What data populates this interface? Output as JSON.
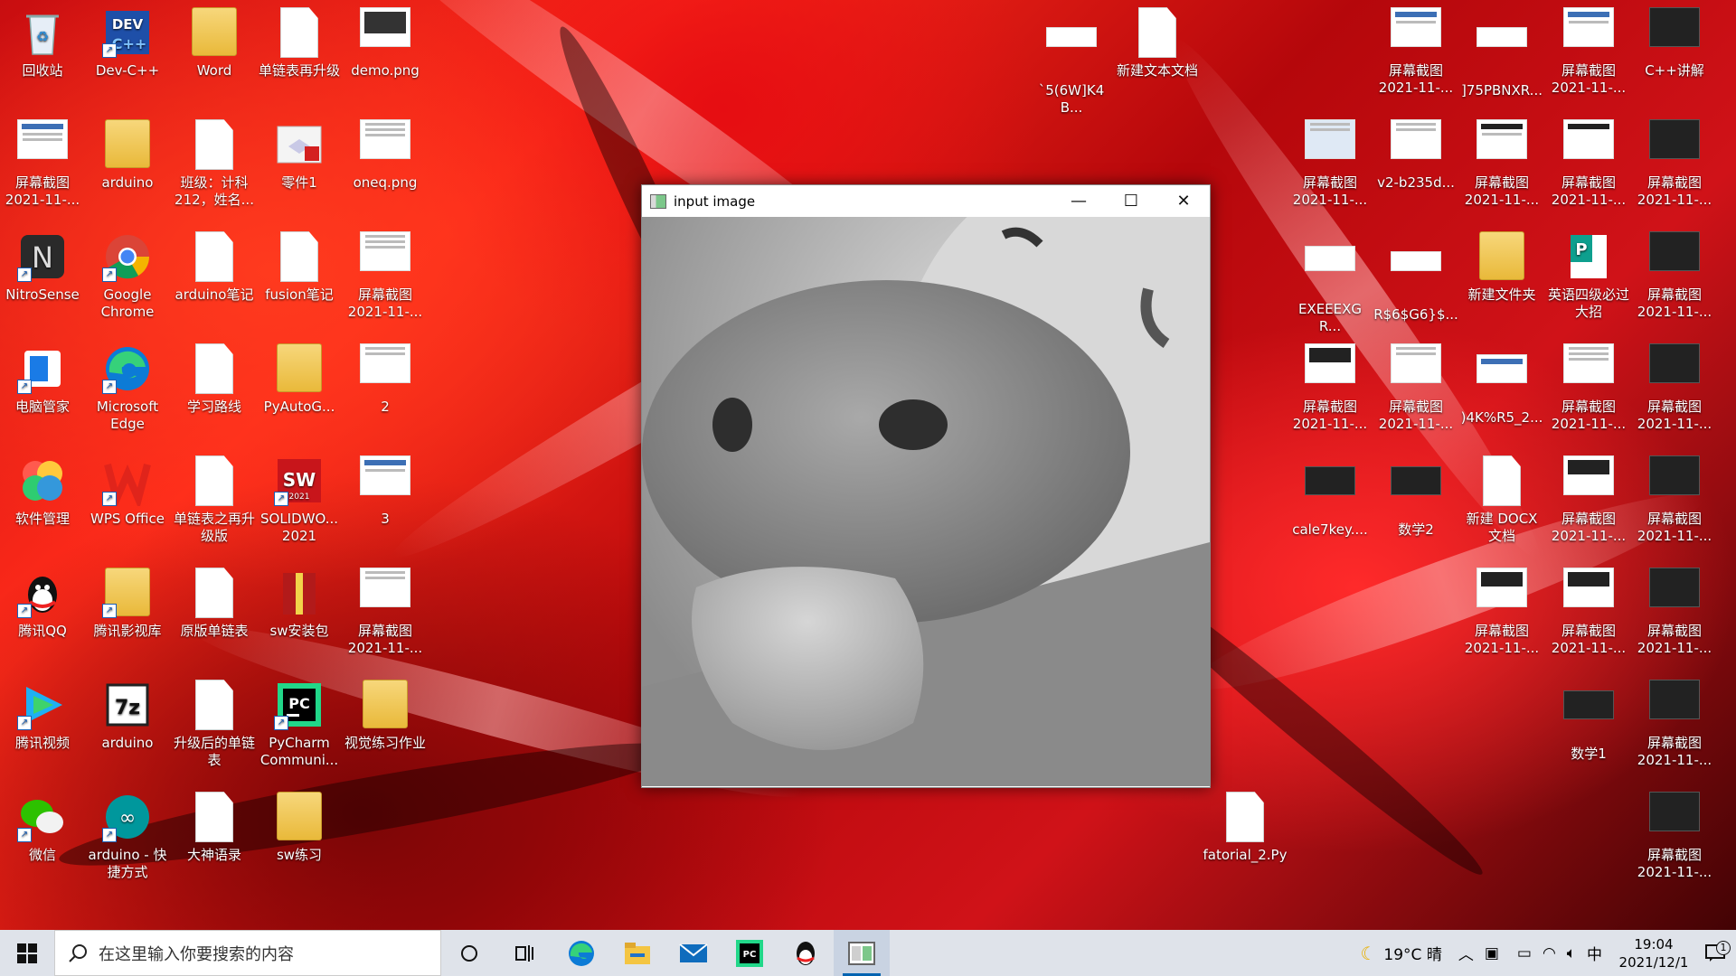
{
  "desktop": {
    "icons": [
      {
        "label": "回收站"
      },
      {
        "label": "Dev-C++"
      },
      {
        "label": "Word"
      },
      {
        "label": "单链表再升级"
      },
      {
        "label": "demo.png"
      },
      {
        "label": "屏幕截图\n2021-11-..."
      },
      {
        "label": "arduino"
      },
      {
        "label": "班级：计科\n212，姓名..."
      },
      {
        "label": "零件1"
      },
      {
        "label": "oneq.png"
      },
      {
        "label": "NitroSense"
      },
      {
        "label": "Google\nChrome"
      },
      {
        "label": "arduino笔记"
      },
      {
        "label": "fusion笔记"
      },
      {
        "label": "屏幕截图\n2021-11-..."
      },
      {
        "label": "电脑管家"
      },
      {
        "label": "Microsoft\nEdge"
      },
      {
        "label": "学习路线"
      },
      {
        "label": "PyAutoG..."
      },
      {
        "label": "2"
      },
      {
        "label": "软件管理"
      },
      {
        "label": "WPS Office"
      },
      {
        "label": "单链表之再升\n级版"
      },
      {
        "label": "SOLIDWO...\n2021"
      },
      {
        "label": "3"
      },
      {
        "label": "腾讯QQ"
      },
      {
        "label": "腾讯影视库"
      },
      {
        "label": "原版单链表"
      },
      {
        "label": "sw安装包"
      },
      {
        "label": "屏幕截图\n2021-11-..."
      },
      {
        "label": "腾讯视频"
      },
      {
        "label": "arduino"
      },
      {
        "label": "升级后的单链\n表"
      },
      {
        "label": "PyCharm\nCommuni..."
      },
      {
        "label": "视觉练习作业"
      },
      {
        "label": "微信"
      },
      {
        "label": "arduino - 快\n捷方式"
      },
      {
        "label": "大神语录"
      },
      {
        "label": "sw练习"
      },
      {
        "label": "`5(6W]K4B..."
      },
      {
        "label": "新建文本文档"
      },
      {
        "label": "fatorial_2.Py"
      },
      {
        "label": "屏幕截图\n2021-11-..."
      },
      {
        "label": "]75PBNXR..."
      },
      {
        "label": "屏幕截图\n2021-11-..."
      },
      {
        "label": "C++讲解"
      },
      {
        "label": "屏幕截图\n2021-11-..."
      },
      {
        "label": "v2-b235d..."
      },
      {
        "label": "屏幕截图\n2021-11-..."
      },
      {
        "label": "屏幕截图\n2021-11-..."
      },
      {
        "label": "屏幕截图\n2021-11-..."
      },
      {
        "label": "EXEEEXGR..."
      },
      {
        "label": "R$6$G6}$..."
      },
      {
        "label": "新建文件夹"
      },
      {
        "label": "英语四级必过\n大招"
      },
      {
        "label": "屏幕截图\n2021-11-..."
      },
      {
        "label": "屏幕截图\n2021-11-..."
      },
      {
        "label": "屏幕截图\n2021-11-..."
      },
      {
        "label": ")4K%R5_2..."
      },
      {
        "label": "屏幕截图\n2021-11-..."
      },
      {
        "label": "屏幕截图\n2021-11-..."
      },
      {
        "label": "cale7key...."
      },
      {
        "label": "数学2"
      },
      {
        "label": "新建 DOCX\n文档"
      },
      {
        "label": "屏幕截图\n2021-11-..."
      },
      {
        "label": "屏幕截图\n2021-11-..."
      },
      {
        "label": "屏幕截图\n2021-11-..."
      },
      {
        "label": "屏幕截图\n2021-11-..."
      },
      {
        "label": "屏幕截图\n2021-11-..."
      },
      {
        "label": "数学1"
      },
      {
        "label": "屏幕截图\n2021-11-..."
      },
      {
        "label": "屏幕截图\n2021-11-..."
      }
    ]
  },
  "window": {
    "title": "input image",
    "minimize_glyph": "—",
    "maximize_glyph": "☐",
    "close_glyph": "✕"
  },
  "taskbar": {
    "search_placeholder": "在这里输入你要搜索的内容",
    "weather": "19°C 晴",
    "ime": "中",
    "time": "19:04",
    "date": "2021/12/1",
    "notification_count": "1"
  },
  "colors": {
    "taskbar_bg": "#dfe3ea",
    "accent": "#0063b1"
  }
}
